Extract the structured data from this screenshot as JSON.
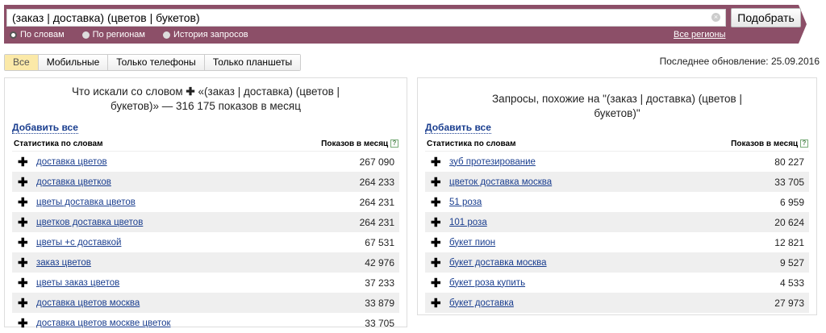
{
  "search": {
    "query": "(заказ | доставка) (цветов | букетов)",
    "button": "Подобрать",
    "modes": [
      "По словам",
      "По регионам",
      "История запросов"
    ],
    "regions": "Все регионы"
  },
  "tabs": [
    "Все",
    "Мобильные",
    "Только телефоны",
    "Только планшеты"
  ],
  "updated": "Последнее обновление: 25.09.2016",
  "left": {
    "title_prefix": "Что искали со словом",
    "title_rest": "«(заказ | доставка) (цветов | букетов)» — 316 175 показов в месяц",
    "add_all": "Добавить все",
    "col1": "Статистика по словам",
    "col2": "Показов в месяц",
    "rows": [
      {
        "kw": "доставка цветов",
        "n": "267 090"
      },
      {
        "kw": "доставка цветков",
        "n": "264 233"
      },
      {
        "kw": "цветы доставка цветов",
        "n": "264 231"
      },
      {
        "kw": "цветков доставка цветов",
        "n": "264 231"
      },
      {
        "kw": "цветы +с доставкой",
        "n": "67 531"
      },
      {
        "kw": "заказ цветов",
        "n": "42 976"
      },
      {
        "kw": "цветы заказ цветов",
        "n": "37 233"
      },
      {
        "kw": "доставка цветов москва",
        "n": "33 879"
      },
      {
        "kw": "доставка цветов москве цветок",
        "n": "33 705"
      }
    ]
  },
  "right": {
    "title": "Запросы, похожие на \"(заказ | доставка) (цветов | букетов)\"",
    "add_all": "Добавить все",
    "col1": "Статистика по словам",
    "col2": "Показов в месяц",
    "rows": [
      {
        "kw": "зуб протезирование",
        "n": "80 227"
      },
      {
        "kw": "цветок доставка москва",
        "n": "33 705"
      },
      {
        "kw": "51 роза",
        "n": "6 959"
      },
      {
        "kw": "101 роза",
        "n": "20 624"
      },
      {
        "kw": "букет пион",
        "n": "12 821"
      },
      {
        "kw": "букет доставка москва",
        "n": "9 527"
      },
      {
        "kw": "букет роза купить",
        "n": "4 533"
      },
      {
        "kw": "букет доставка",
        "n": "27 973"
      }
    ]
  }
}
